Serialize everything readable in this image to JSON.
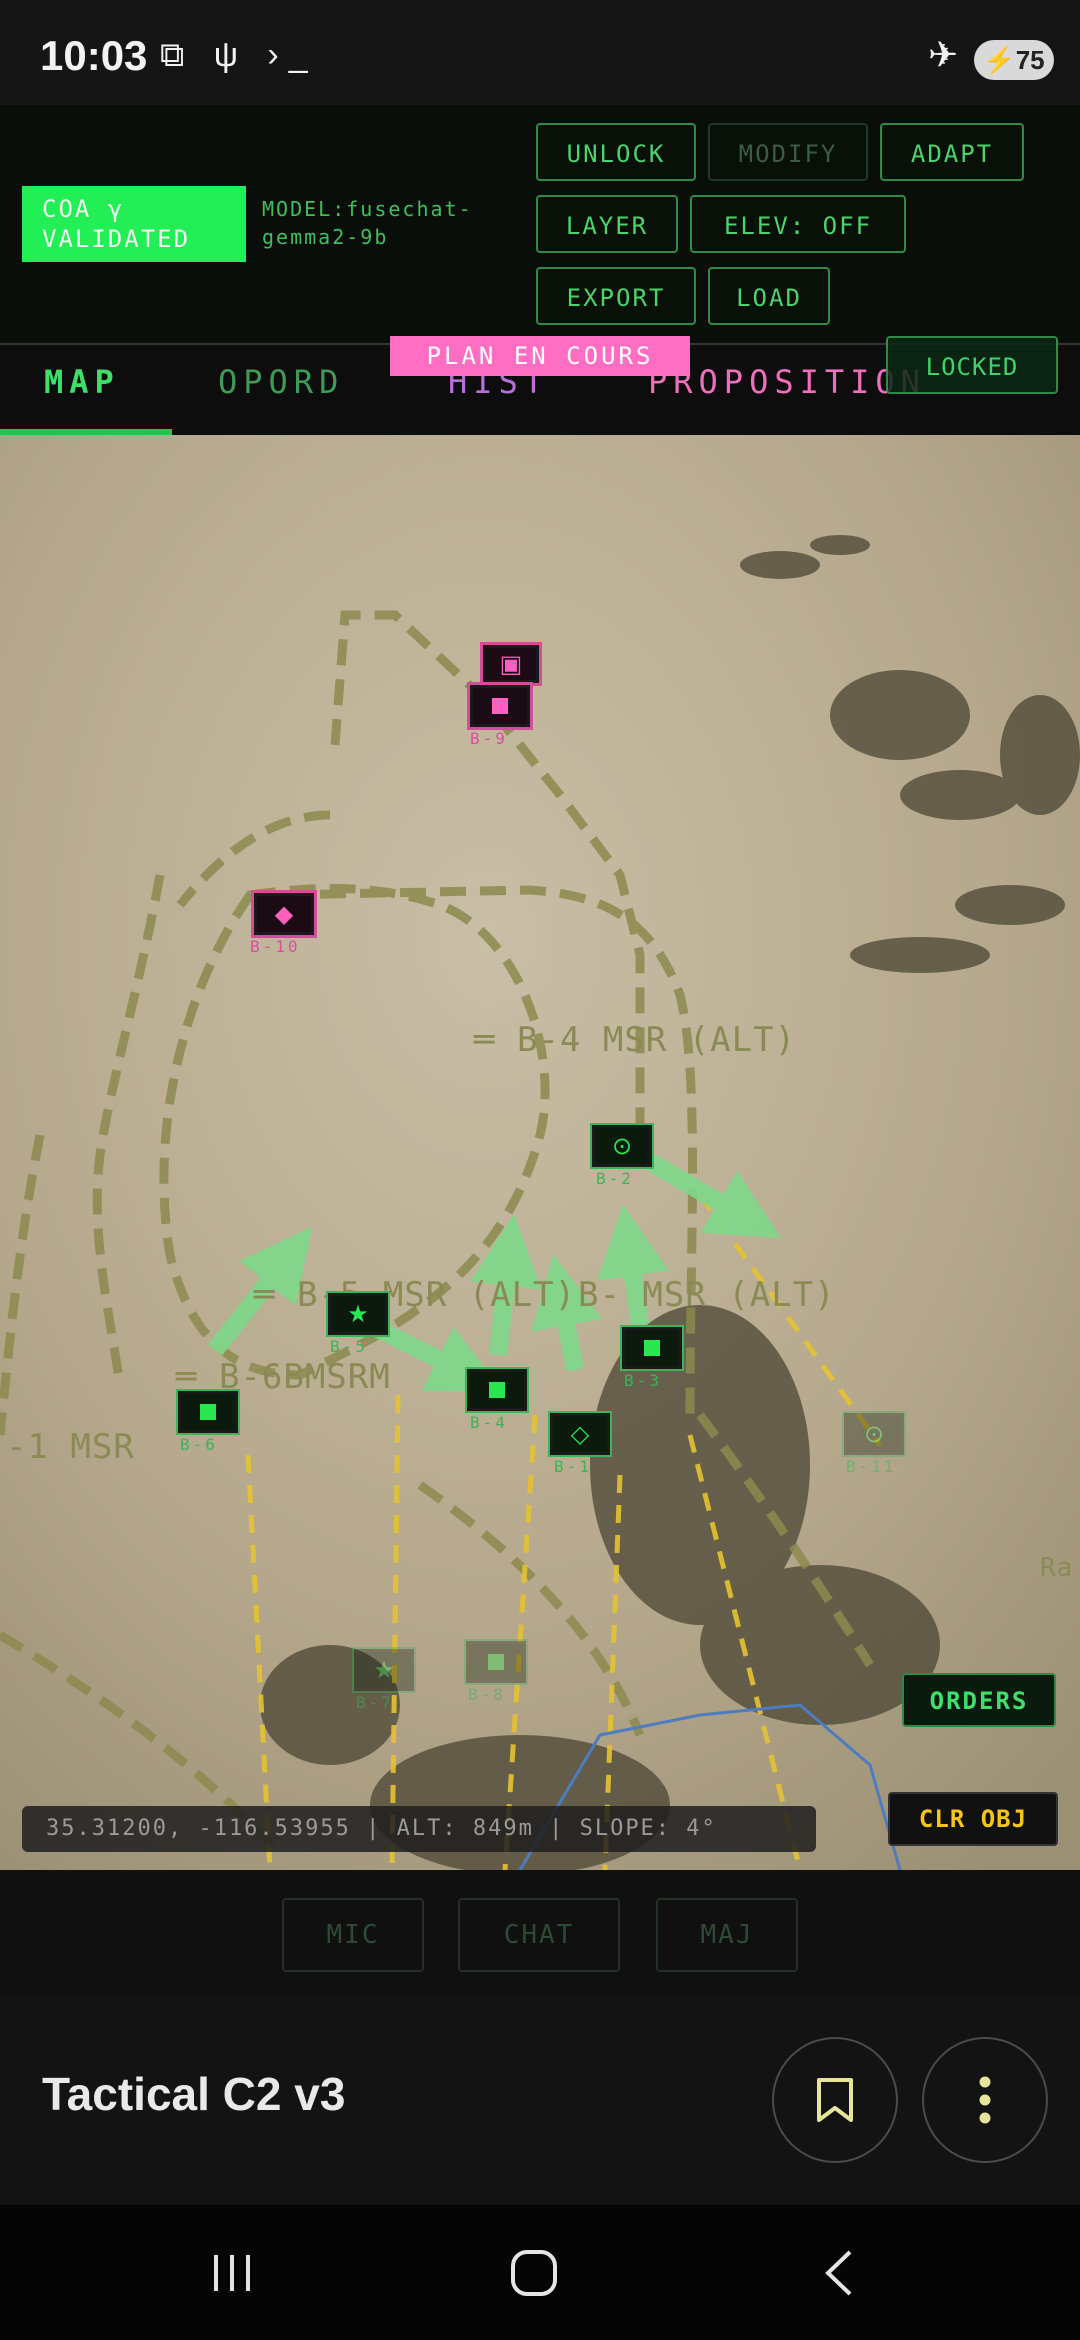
{
  "status_bar": {
    "time": "10:03",
    "notif_icons": "⧉ ψ ›_",
    "battery": "75"
  },
  "header": {
    "coa_status_line1": "COA γ",
    "coa_status_line2": "VALIDATED",
    "model_line1": "MODEL:fusechat-",
    "model_line2": "gemma2-9b",
    "buttons": {
      "unlock": "UNLOCK",
      "modify": "MODIFY",
      "adapt": "ADAPT",
      "layer": "LAYER",
      "elev": "ELEV: OFF",
      "export": "EXPORT",
      "load": "LOAD"
    }
  },
  "tabs": {
    "map": "MAP",
    "opord": "OPORD",
    "hist": "HIST",
    "proposition": "PROPOSITION"
  },
  "badges": {
    "plan": "PLAN EN COURS",
    "locked": "LOCKED"
  },
  "map": {
    "routes": {
      "b4": "═ B-4 MSR (ALT)",
      "b5": "═ B-5 MSR (ALT)",
      "b_alt": "B- MSR (ALT)",
      "b6": "═ B-6BMSRM",
      "msr1": "-1 MSR",
      "edge": "Ra"
    },
    "unit_labels": {
      "enemy_top": "B-9",
      "enemy_left": "B-10",
      "friendly_b2": "B-2",
      "friendly_b5": "B-5",
      "friendly_b3": "B-3",
      "friendly_b4": "B-4",
      "friendly_b1": "B-1",
      "friendly_b6": "B-6",
      "faded_b7": "B-7",
      "faded_b8": "B-8",
      "faded_b11": "B-11"
    },
    "colors": {
      "friendly": "#27e64e",
      "enemy": "#ff5fbf",
      "axis_arrow": "#7ed88a",
      "route_yellow": "#e6c232",
      "route_olive": "#8d8a4e"
    }
  },
  "overlay": {
    "orders": "ORDERS",
    "clear_obj": "CLR OBJ",
    "coords": "35.31200, -116.53955 | ALT: 849m | SLOPE: 4°"
  },
  "controls": {
    "mic": "MIC",
    "chat": "CHAT",
    "maj": "MAJ"
  },
  "app_bar": {
    "title": "Tactical C2 v3"
  }
}
